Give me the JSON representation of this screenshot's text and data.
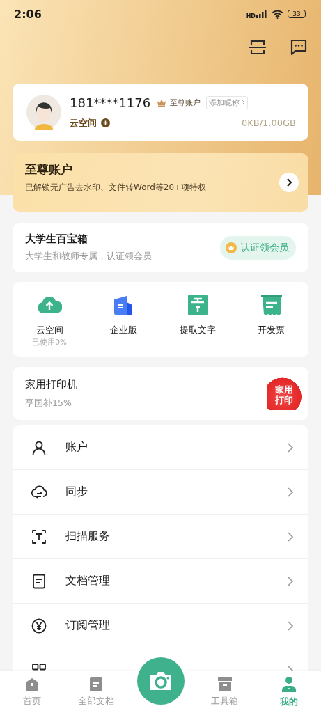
{
  "status_bar": {
    "time": "2:06",
    "network_label": "HD",
    "battery": "33"
  },
  "profile": {
    "phone": "181****1176",
    "tier": "至尊账户",
    "nickname_button": "添加昵称",
    "cloud_label": "云空间",
    "storage": "0KB/1.00GB"
  },
  "premium": {
    "title": "至尊账户",
    "subtitle": "已解锁无广告去水印、文件转Word等20+项特权"
  },
  "student": {
    "title": "大学生百宝箱",
    "subtitle": "大学生和教师专属，认证领会员",
    "button": "认证领会员"
  },
  "tools": [
    {
      "kind": "cloud",
      "label": "云空间",
      "note": "已使用0%"
    },
    {
      "kind": "enterprise",
      "label": "企业版"
    },
    {
      "kind": "extract",
      "label": "提取文字"
    },
    {
      "kind": "invoice",
      "label": "开发票"
    }
  ],
  "printer": {
    "title": "家用打印机",
    "subtitle": "享国补15%",
    "badge_lines": [
      "家用",
      "打印"
    ]
  },
  "menu": [
    {
      "kind": "account",
      "label": "账户"
    },
    {
      "kind": "sync",
      "label": "同步"
    },
    {
      "kind": "scan",
      "label": "扫描服务"
    },
    {
      "kind": "document",
      "label": "文档管理"
    },
    {
      "kind": "subscription",
      "label": "订阅管理"
    },
    {
      "kind": "widget"
    }
  ],
  "tabs": [
    {
      "kind": "home",
      "label": "首页",
      "selected": false
    },
    {
      "kind": "docs",
      "label": "全部文档",
      "selected": false
    },
    {
      "kind": "toolbox",
      "label": "工具箱",
      "selected": false
    },
    {
      "kind": "me",
      "label": "我的",
      "selected": true
    }
  ]
}
